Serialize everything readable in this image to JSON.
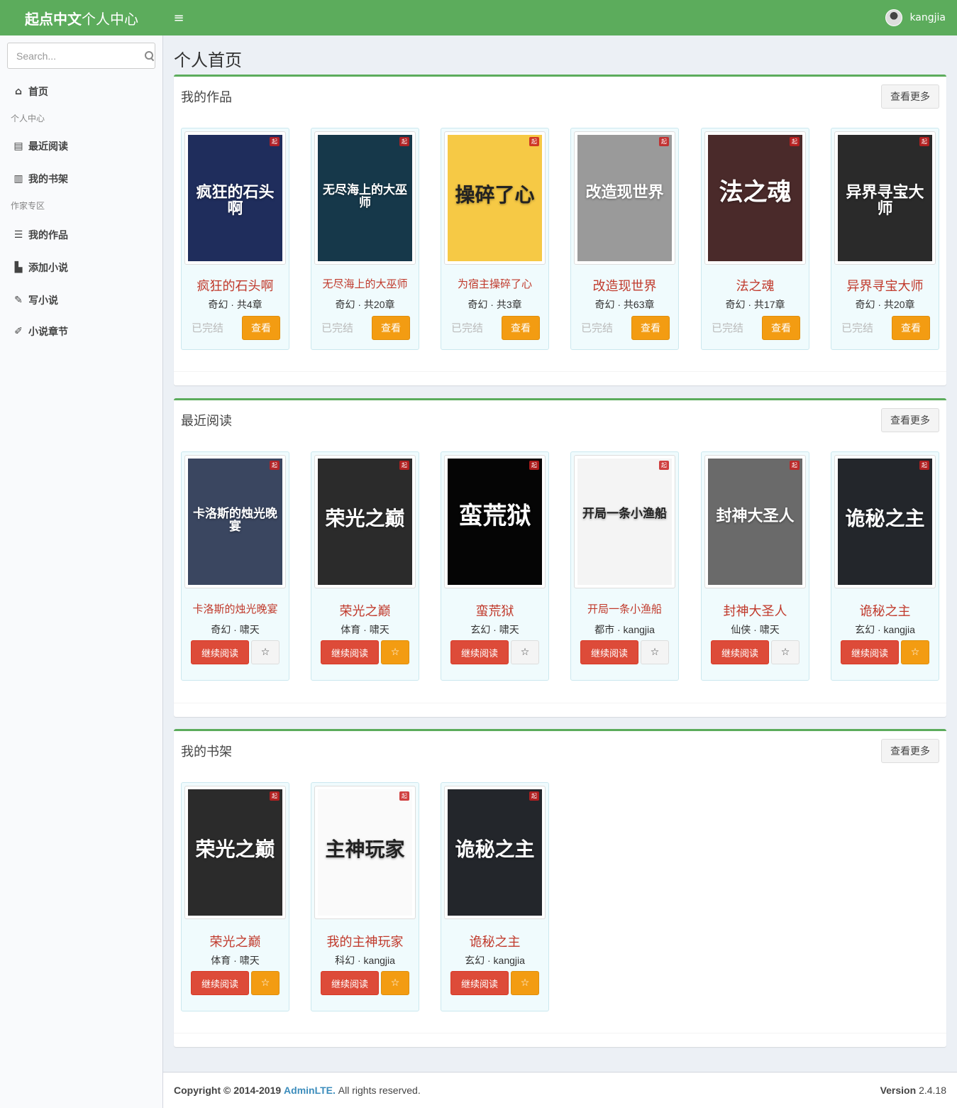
{
  "header": {
    "brand_bold": "起点中文",
    "brand_rest": "个人中心",
    "username": "kangjia",
    "menu_toggle": "≡"
  },
  "sidebar": {
    "search_placeholder": "Search...",
    "home": "首页",
    "section_personal": "个人中心",
    "recent": "最近阅读",
    "shelf": "我的书架",
    "section_author": "作家专区",
    "works": "我的作品",
    "add_novel": "添加小说",
    "write": "写小说",
    "chapters": "小说章节"
  },
  "page_title": "个人首页",
  "more_label": "查看更多",
  "works": {
    "title": "我的作品",
    "view_label": "查看",
    "books": [
      {
        "title": "疯狂的石头啊",
        "meta": "奇幻 · 共4章",
        "status": "已完结",
        "cover_text": "疯狂的石头啊",
        "cover_bg": "#1f2d5c"
      },
      {
        "title": "无尽海上的大巫师",
        "meta": "奇幻 · 共20章",
        "status": "已完结",
        "cover_text": "无尽海上的大巫师",
        "cover_bg": "#16384a"
      },
      {
        "title": "为宿主操碎了心",
        "meta": "奇幻 · 共3章",
        "status": "已完结",
        "cover_text": "操碎了心",
        "cover_bg": "#f6c945"
      },
      {
        "title": "改造现世界",
        "meta": "奇幻 · 共63章",
        "status": "已完结",
        "cover_text": "改造现世界",
        "cover_bg": "#9a9a9a"
      },
      {
        "title": "法之魂",
        "meta": "奇幻 · 共17章",
        "status": "已完结",
        "cover_text": "法之魂",
        "cover_bg": "#4a2a2a"
      },
      {
        "title": "异界寻宝大师",
        "meta": "奇幻 · 共20章",
        "status": "已完结",
        "cover_text": "异界寻宝大师",
        "cover_bg": "#2a2a2a"
      }
    ]
  },
  "recent": {
    "title": "最近阅读",
    "read_label": "继续阅读",
    "star_label": "☆",
    "books": [
      {
        "title": "卡洛斯的烛光晚宴",
        "meta": "奇幻 · 啸天",
        "starred": false,
        "cover_text": "卡洛斯的烛光晚宴",
        "cover_bg": "#3a4660"
      },
      {
        "title": "荣光之巅",
        "meta": "体育 · 啸天",
        "starred": true,
        "cover_text": "荣光之巅",
        "cover_bg": "#2b2b2b"
      },
      {
        "title": "蛮荒狱",
        "meta": "玄幻 · 啸天",
        "starred": false,
        "cover_text": "蛮荒狱",
        "cover_bg": "#050505"
      },
      {
        "title": "开局一条小渔船",
        "meta": "都市 · kangjia",
        "starred": false,
        "cover_text": "开局一条小渔船",
        "cover_bg": "#f4f4f4"
      },
      {
        "title": "封神大圣人",
        "meta": "仙侠 · 啸天",
        "starred": false,
        "cover_text": "封神大圣人",
        "cover_bg": "#6a6a6a"
      },
      {
        "title": "诡秘之主",
        "meta": "玄幻 · kangjia",
        "starred": true,
        "cover_text": "诡秘之主",
        "cover_bg": "#23262b"
      }
    ]
  },
  "shelf": {
    "title": "我的书架",
    "read_label": "继续阅读",
    "star_label": "☆",
    "books": [
      {
        "title": "荣光之巅",
        "meta": "体育 · 啸天",
        "starred": true,
        "cover_text": "荣光之巅",
        "cover_bg": "#2b2b2b"
      },
      {
        "title": "我的主神玩家",
        "meta": "科幻 · kangjia",
        "starred": true,
        "cover_text": "主神玩家",
        "cover_bg": "#fafafa"
      },
      {
        "title": "诡秘之主",
        "meta": "玄幻 · kangjia",
        "starred": true,
        "cover_text": "诡秘之主",
        "cover_bg": "#23262b"
      }
    ]
  },
  "footer": {
    "copyright": "Copyright © 2014-2019",
    "brand": "AdminLTE.",
    "rights": "All rights reserved.",
    "version_label": "Version",
    "version": "2.4.18"
  },
  "colors": {
    "header": "#5cac5c",
    "accent_orange": "#f39c12",
    "accent_red": "#dd4b39",
    "title_red": "#c0392b"
  }
}
